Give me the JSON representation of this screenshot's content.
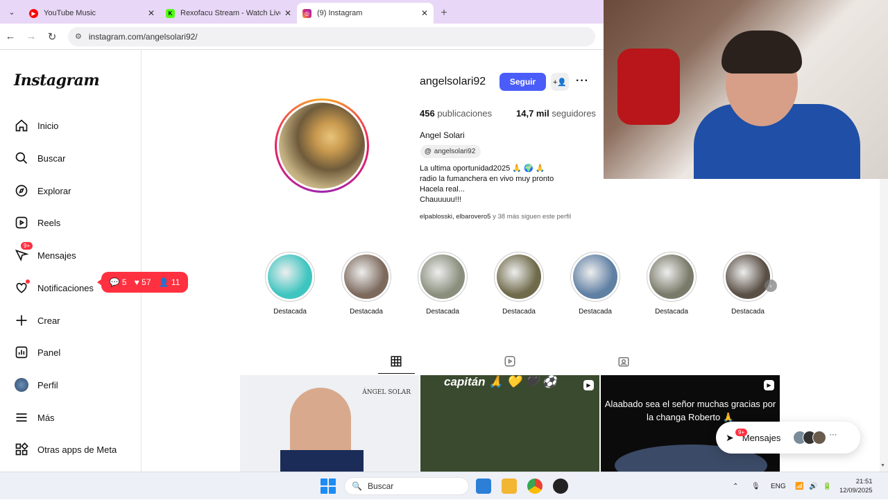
{
  "browser": {
    "tabs": [
      {
        "title": "YouTube Music",
        "favicon_color": "#ff0000",
        "active": false
      },
      {
        "title": "Rexofacu Stream - Watch Live o",
        "favicon_color": "#53fc18",
        "active": false
      },
      {
        "title": "(9) Instagram",
        "favicon_color": "#d62976",
        "active": true
      }
    ],
    "url": "instagram.com/angelsolari92/"
  },
  "sidebar": {
    "logo": "Instagram",
    "items": [
      {
        "label": "Inicio",
        "icon": "home-icon"
      },
      {
        "label": "Buscar",
        "icon": "search-icon"
      },
      {
        "label": "Explorar",
        "icon": "compass-icon"
      },
      {
        "label": "Reels",
        "icon": "reels-icon"
      },
      {
        "label": "Mensajes",
        "icon": "messenger-icon",
        "badge": "9+"
      },
      {
        "label": "Notificaciones",
        "icon": "heart-icon"
      },
      {
        "label": "Crear",
        "icon": "plus-icon"
      },
      {
        "label": "Panel",
        "icon": "chart-icon"
      },
      {
        "label": "Perfil",
        "icon": "avatar-icon"
      },
      {
        "label": "Más",
        "icon": "menu-icon"
      },
      {
        "label": "Otras apps de Meta",
        "icon": "meta-apps-icon"
      }
    ],
    "notif_pill": {
      "comments": "5",
      "likes": "57",
      "follows": "11"
    }
  },
  "profile": {
    "username": "angelsolari92",
    "follow_label": "Seguir",
    "posts_count": "456",
    "posts_label": "publicaciones",
    "followers_count": "14,7 mil",
    "followers_label": "seguidores",
    "full_name": "Angel Solari",
    "threads_handle": "angelsolari92",
    "bio": "La ultima oportunidad2025 🙏 🌍 🙏\nradio la fumanchera en vivo muy pronto\nHacela real...\nChauuuuu!!!",
    "followed_by_names": "elpablosski, elbarovero5",
    "followed_by_rest": " y 38 más siguen este perfil"
  },
  "highlights": [
    {
      "label": "Destacada",
      "color": "#3ec5c0"
    },
    {
      "label": "Destacada",
      "color": "#7d6a5d"
    },
    {
      "label": "Destacada",
      "color": "#8a8f7d"
    },
    {
      "label": "Destacada",
      "color": "#6f6a4a"
    },
    {
      "label": "Destacada",
      "color": "#5f7fa3"
    },
    {
      "label": "Destacada",
      "color": "#7a7a6a"
    },
    {
      "label": "Destacada",
      "color": "#5a4f45"
    }
  ],
  "posts": [
    {
      "caption": "ÁNGEL SOLAR",
      "type": "image"
    },
    {
      "caption": "capitán 🙏 💛 🖤 ⚽",
      "type": "reel"
    },
    {
      "caption": "Alaabado sea el señor muchas gracias por la changa Roberto 🙏",
      "type": "reel"
    }
  ],
  "messages_fab": {
    "label": "Mensajes",
    "badge": "9+"
  },
  "taskbar": {
    "search_placeholder": "Buscar",
    "lang": "ENG",
    "time": "21:51",
    "date": "12/09/2025"
  },
  "colors": {
    "accent": "#4a5df9",
    "badge": "#ff3040",
    "tabbar": "#e8d7f6"
  }
}
